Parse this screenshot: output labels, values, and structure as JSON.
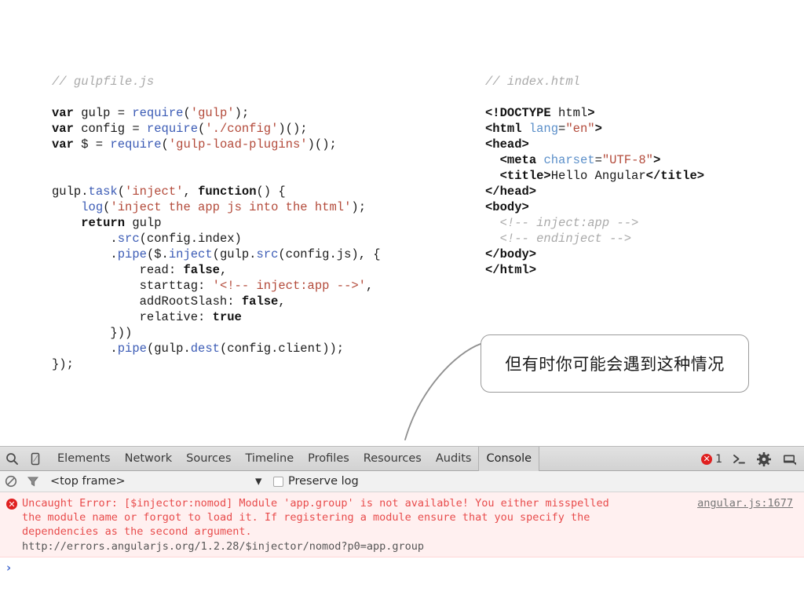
{
  "gulpfile": {
    "comment": "// gulpfile.js",
    "lines": [
      "var gulp = require('gulp');",
      "var config = require('./config')();",
      "var $ = require('gulp-load-plugins')();",
      "gulp.task('inject', function() {",
      "    log('inject the app js into the html');",
      "    return gulp",
      "        .src(config.index)",
      "        .pipe($.inject(gulp.src(config.js), {",
      "            read: false,",
      "            starttag: '<!-- inject:app -->',",
      "            addRootSlash: false,",
      "            relative: true",
      "        }))",
      "        .pipe(gulp.dest(config.client));",
      "});"
    ]
  },
  "indexhtml": {
    "comment": "// index.html",
    "lines": [
      "<!DOCTYPE html>",
      "<html lang=\"en\">",
      "<head>",
      "  <meta charset=\"UTF-8\">",
      "  <title>Hello Angular</title>",
      "</head>",
      "<body>",
      "  <!-- inject:app -->",
      "  <!-- endinject -->",
      "</body>",
      "</html>"
    ]
  },
  "callout": {
    "text": "但有时你可能会遇到这种情况",
    "border_color": "#9a9a9a"
  },
  "devtools": {
    "tabs": [
      {
        "label": "Elements",
        "selected": false
      },
      {
        "label": "Network",
        "selected": false
      },
      {
        "label": "Sources",
        "selected": false
      },
      {
        "label": "Timeline",
        "selected": false
      },
      {
        "label": "Profiles",
        "selected": false
      },
      {
        "label": "Resources",
        "selected": false
      },
      {
        "label": "Audits",
        "selected": false
      },
      {
        "label": "Console",
        "selected": true
      }
    ],
    "left_icons": [
      "search-icon",
      "device-toggle-icon"
    ],
    "right_icons": [
      "console-prompt-icon",
      "gear-icon",
      "dock-icon"
    ],
    "error_count": "1",
    "error_badge_glyph": "✕",
    "filter_bar": {
      "clear_icon": "clear-console-icon",
      "filter_icon": "filter-icon",
      "frame": "<top frame>",
      "caret": "▼",
      "preserve_log": "Preserve log",
      "preserve_checked": false
    },
    "console": {
      "error_icon_glyph": "✕",
      "error_message": "Uncaught Error: [$injector:nomod] Module 'app.group' is not available! You either misspelled the module name or forgot to load it. If registering a module ensure that you specify the dependencies as the second argument.",
      "error_url": "http://errors.angularjs.org/1.2.28/$injector/nomod?p0=app.group",
      "error_source": "angular.js:1677",
      "error_color": "#e84b4b",
      "error_bg": "#fff0f0",
      "prompt": "›"
    }
  }
}
